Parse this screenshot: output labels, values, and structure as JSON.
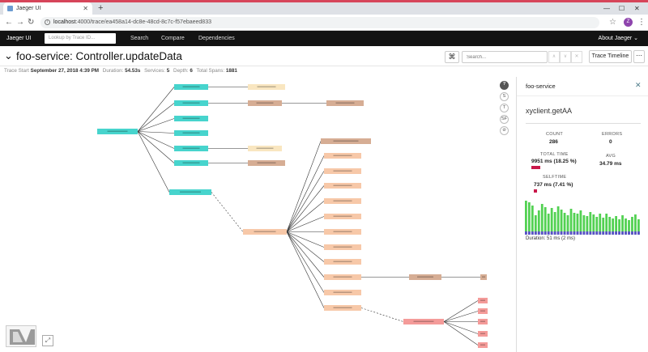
{
  "browser": {
    "tab_title": "Jaeger UI",
    "url_host": "localhost",
    "url_path": ":4000/trace/ea458a14-dc8e-48cd-8c7c-f57ebaeed833"
  },
  "topnav": {
    "brand": "Jaeger UI",
    "lookup_placeholder": "Lookup by Trace ID...",
    "links": [
      "Search",
      "Compare",
      "Dependencies"
    ],
    "about": "About Jaeger ⌄"
  },
  "trace": {
    "title": "foo-service: Controller.updateData",
    "search_placeholder": "Search...",
    "view_button": "Trace Timeline",
    "meta": {
      "trace_start_label": "Trace Start",
      "trace_start": "September 27, 2018 4:39 PM",
      "duration_label": "Duration:",
      "duration": "54.53s",
      "services_label": "Services:",
      "services": "5",
      "depth_label": "Depth:",
      "depth": "6",
      "spans_label": "Total Spans:",
      "spans": "1881"
    }
  },
  "graph_controls": [
    "?",
    "S",
    "T",
    "SF",
    "⊘"
  ],
  "panel": {
    "service": "foo-service",
    "operation": "xyclient.getAA",
    "count_label": "COUNT",
    "count": "286",
    "errors_label": "ERRORS",
    "errors": "0",
    "total_time_label": "TOTAL TIME",
    "total_time": "9951 ms (18.25 %)",
    "avg_label": "AVG",
    "avg": "34.79 ms",
    "self_time_label": "SELFTIME",
    "self_time": "737 ms (7.41 %)",
    "duration_caption": "Duration: 51 ms (2 ms)",
    "total_time_fraction": 0.1825,
    "self_time_fraction": 0.0741
  },
  "colors": {
    "teal": "#47d4cd",
    "peach": "#f7c8a8",
    "tan": "#d6ad94",
    "cream": "#f9e6c0",
    "salmon": "#f49b99",
    "green_bar": "#52d152",
    "blue_bar": "#5a50c8",
    "error_red": "#c9184a"
  }
}
